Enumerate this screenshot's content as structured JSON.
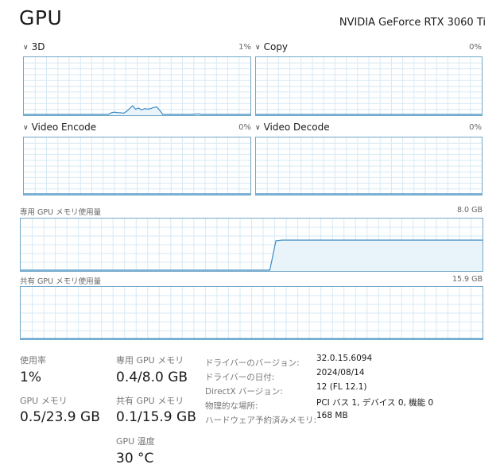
{
  "title": "GPU",
  "device_name": "NVIDIA GeForce RTX 3060 Ti",
  "engines": [
    {
      "name": "3D",
      "percent": "1%"
    },
    {
      "name": "Copy",
      "percent": "0%"
    },
    {
      "name": "Video Encode",
      "percent": "0%"
    },
    {
      "name": "Video Decode",
      "percent": "0%"
    }
  ],
  "dedicated_memory": {
    "label": "専用 GPU メモリ使用量",
    "max": "8.0 GB"
  },
  "shared_memory": {
    "label": "共有 GPU メモリ使用量",
    "max": "15.9 GB"
  },
  "stats": {
    "utilization": {
      "label": "使用率",
      "value": "1%"
    },
    "gpu_memory": {
      "label": "GPU メモリ",
      "value": "0.5/23.9 GB"
    },
    "dedicated": {
      "label": "専用 GPU メモリ",
      "value": "0.4/8.0 GB"
    },
    "shared": {
      "label": "共有 GPU メモリ",
      "value": "0.1/15.9 GB"
    },
    "temperature": {
      "label": "GPU 温度",
      "value": "30 °C"
    }
  },
  "info": [
    {
      "key": "ドライバーのバージョン:",
      "value": "32.0.15.6094"
    },
    {
      "key": "ドライバーの日付:",
      "value": "2024/08/14"
    },
    {
      "key": "DirectX バージョン:",
      "value": "12 (FL 12.1)"
    },
    {
      "key": "物理的な場所:",
      "value": "PCI バス 1, デバイス 0, 機能 0"
    },
    {
      "key": "ハードウェア予約済みメモリ:",
      "value": "168 MB"
    }
  ],
  "colors": {
    "graph_border": "#72a8c8",
    "graph_grid": "#d7e9f4",
    "graph_line": "#3b8ac4",
    "graph_fill": "#e9f3fa"
  },
  "series": {
    "engine_3d": [
      0,
      0,
      0,
      0,
      0,
      0,
      0,
      0,
      0,
      0,
      0,
      0,
      0,
      0,
      0,
      0,
      0,
      0,
      0,
      0,
      0,
      0,
      0,
      0,
      0,
      0,
      0,
      0,
      0,
      3,
      4,
      3,
      3,
      2,
      5,
      10,
      15,
      9,
      11,
      8,
      10,
      9,
      10,
      12,
      13,
      7,
      0,
      0,
      0,
      0,
      0,
      0,
      0,
      0,
      0,
      0,
      0,
      1,
      1,
      0,
      0,
      0,
      0,
      0,
      0,
      0,
      0,
      0,
      0,
      0,
      0,
      0,
      0,
      0,
      0,
      0
    ],
    "copy": [
      0,
      0,
      0,
      0,
      0,
      0,
      0,
      0,
      0,
      0,
      0,
      0,
      0,
      0,
      0,
      0,
      0,
      0,
      0,
      0,
      0,
      0,
      0,
      0,
      0,
      0,
      0,
      0,
      0,
      0,
      0,
      0,
      0,
      0,
      0,
      0,
      0,
      0,
      0,
      0,
      0,
      0,
      0,
      0,
      0,
      0,
      0,
      0,
      0,
      0,
      0,
      0,
      0,
      0,
      0,
      0,
      0,
      0,
      0,
      0,
      0,
      0,
      0,
      0,
      0,
      0,
      0,
      0,
      0,
      0,
      0,
      0,
      0,
      0,
      0,
      0
    ],
    "video_encode": [
      0,
      0,
      0,
      0,
      0,
      0,
      0,
      0,
      0,
      0,
      0,
      0,
      0,
      0,
      0,
      0,
      0,
      0,
      0,
      0,
      0,
      0,
      0,
      0,
      0,
      0,
      0,
      0,
      0,
      0,
      0,
      0,
      0,
      0,
      0,
      0,
      0,
      0,
      0,
      0,
      0,
      0,
      0,
      0,
      0,
      0,
      0,
      0,
      0,
      0,
      0,
      0,
      0,
      0,
      0,
      0,
      0,
      0,
      0,
      0,
      0,
      0,
      0,
      0,
      0,
      0,
      0,
      0,
      0,
      0,
      0,
      0,
      0,
      0,
      0,
      0
    ],
    "video_decode": [
      0,
      0,
      0,
      0,
      0,
      0,
      0,
      0,
      0,
      0,
      0,
      0,
      0,
      0,
      0,
      0,
      0,
      0,
      0,
      0,
      0,
      0,
      0,
      0,
      0,
      0,
      0,
      0,
      0,
      0,
      0,
      0,
      0,
      0,
      0,
      0,
      0,
      0,
      0,
      0,
      0,
      0,
      0,
      0,
      0,
      0,
      0,
      0,
      0,
      0,
      0,
      0,
      0,
      0,
      0,
      0,
      0,
      0,
      0,
      0,
      0,
      0,
      0,
      0,
      0,
      0,
      0,
      0,
      0,
      0,
      0,
      0,
      0,
      0,
      0,
      0
    ],
    "dedicated_mem": [
      0,
      0,
      0,
      0,
      0,
      0,
      0,
      0,
      0,
      0,
      0,
      0,
      0,
      0,
      0,
      0,
      0,
      0,
      0,
      0,
      0,
      0,
      0,
      0,
      0,
      0,
      0,
      0,
      0,
      0,
      0,
      0,
      0,
      0,
      0,
      0,
      0,
      0,
      0,
      0,
      0,
      0,
      4.5,
      4.6,
      4.6,
      4.6,
      4.6,
      4.6,
      4.6,
      4.6,
      4.6,
      4.6,
      4.6,
      4.6,
      4.6,
      4.6,
      4.6,
      4.6,
      4.6,
      4.6,
      4.6,
      4.6,
      4.6,
      4.6,
      4.6,
      4.6,
      4.6,
      4.6,
      4.6,
      4.6,
      4.6,
      4.6,
      4.6,
      4.6,
      4.6,
      4.6,
      4.6
    ],
    "shared_mem": [
      0,
      0,
      0,
      0,
      0,
      0,
      0,
      0,
      0,
      0,
      0,
      0,
      0,
      0,
      0,
      0,
      0,
      0,
      0,
      0,
      0,
      0,
      0,
      0,
      0,
      0,
      0,
      0,
      0,
      0,
      0,
      0,
      0,
      0,
      0,
      0,
      0,
      0,
      0,
      0,
      0,
      0,
      0,
      0,
      0,
      0,
      0,
      0,
      0,
      0,
      0,
      0,
      0,
      0,
      0,
      0,
      0,
      0,
      0,
      0,
      0,
      0,
      0,
      0,
      0,
      0,
      0,
      0,
      0,
      0,
      0,
      0,
      0,
      0,
      0,
      0
    ]
  }
}
